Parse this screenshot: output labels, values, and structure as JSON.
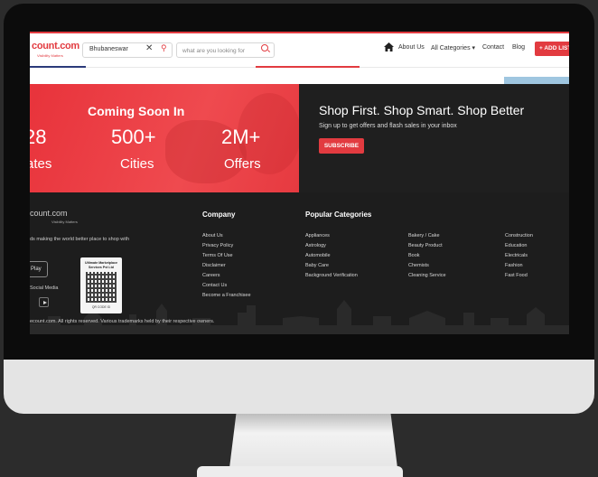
{
  "header": {
    "logo_text": "count.com",
    "logo_tagline": "Visibility Matters",
    "location": "Bhubaneswar",
    "search_placeholder": "what are you looking for",
    "nav": {
      "about": "About Us",
      "categories": "All Categories ▾",
      "contact": "Contact",
      "blog": "Blog"
    },
    "add_listing": "+ ADD LIST"
  },
  "banner": {
    "coming_soon": "Coming Soon In",
    "stats": [
      {
        "num": "28",
        "label": "ates"
      },
      {
        "num": "500+",
        "label": "Cities"
      },
      {
        "num": "2M+",
        "label": "Offers"
      }
    ],
    "shop_title": "Shop First. Shop Smart. Shop Better",
    "shop_subtitle": "Sign up to get offers and flash sales in your inbox",
    "subscribe_label": "SUBSCRIBE"
  },
  "footer": {
    "logo_text": "count.com",
    "logo_tagline": "Visibility Matters",
    "mission": "ds making the world better place to shop with",
    "play_label": "Play",
    "social_label": "Social Media",
    "qr_title": "Ultimate Marketplace Services Pvt Ltd",
    "qr_code_text": "QR CODE ID",
    "copyright": "ecount.com. All rights reserved. Various trademarks held by their respective owners.",
    "company": {
      "title": "Company",
      "links": [
        "About Us",
        "Privacy Policy",
        "Terms Of Use",
        "Disclaimer",
        "Careers",
        "Contact Us",
        "Become a Franchisee"
      ]
    },
    "popular": {
      "title": "Popular Categories",
      "col1": [
        "Appliances",
        "Astrology",
        "Automobile",
        "Baby Care",
        "Background Verification"
      ],
      "col2": [
        "Bakery / Cake",
        "Beauty Product",
        "Book",
        "Chemists",
        "Cleaning Service"
      ],
      "col3": [
        "Construction",
        "Education",
        "Electricals",
        "Fashion",
        "Fast Food"
      ]
    }
  },
  "colors": {
    "brand_red": "#e23b40",
    "dark": "#1d1d1d",
    "monitor_bezel": "#0c0c0c",
    "monitor_chin": "#e4e4e4"
  }
}
